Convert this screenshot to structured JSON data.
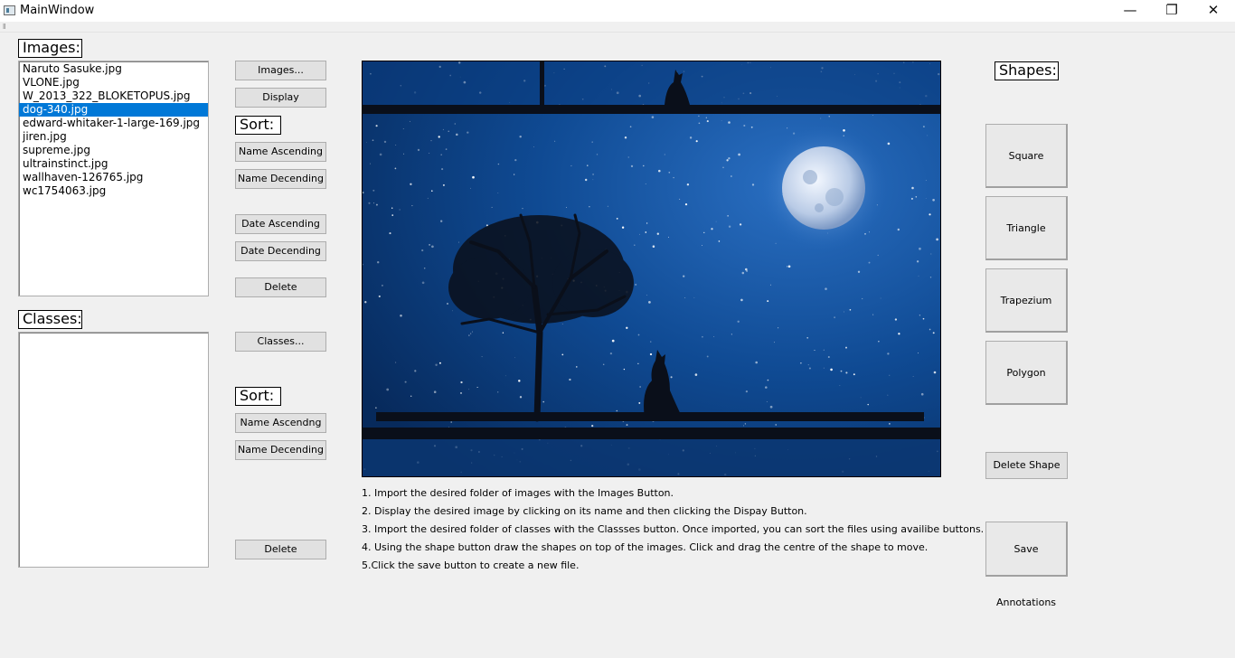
{
  "window": {
    "title": "MainWindow",
    "minimize_glyph": "—",
    "maximize_glyph": "❐",
    "close_glyph": "✕"
  },
  "images_panel": {
    "label": "Images:",
    "files": [
      "Naruto Sasuke.jpg",
      "VLONE.jpg",
      "W_2013_322_BLOKETOPUS.jpg",
      "dog-340.jpg",
      "edward-whitaker-1-large-169.jpg",
      "jiren.jpg",
      "supreme.jpg",
      "ultrainstinct.jpg",
      "wallhaven-126765.jpg",
      "wc1754063.jpg"
    ],
    "selected_file": "dog-340.jpg"
  },
  "classes_panel": {
    "label": "Classes:",
    "items": []
  },
  "buttons": {
    "images": "Images...",
    "display": "Display",
    "sort_label_1": "Sort:",
    "name_ascending": "Name Ascending",
    "name_decending": "Name Decending",
    "date_ascending": "Date Ascending",
    "date_decending": "Date Decending",
    "delete_image": "Delete",
    "classes": "Classes...",
    "sort_label_2": "Sort:",
    "class_name_ascending": "Name Ascendng",
    "class_name_decending": "Name Decending",
    "delete_class": "Delete"
  },
  "shapes_panel": {
    "label": "Shapes:",
    "square": "Square",
    "triangle": "Triangle",
    "trapezium": "Trapezium",
    "polygon": "Polygon",
    "delete_shape": "Delete Shape",
    "save_annotations": "Save Annotations"
  },
  "instructions": [
    "1. Import the desired folder of images with the Images Button.",
    "2. Display the desired image by clicking on its name and then clicking the Dispay Button.",
    "3. Import the desired folder of classes with the Classses button. Once imported, you can sort the files using availibe buttons.",
    "4. Using the shape button draw the shapes on top of the images. Click and drag the centre of the shape to move.",
    "5.Click the save button to create a new file."
  ],
  "colors": {
    "selection": "#0078d7",
    "window_bg": "#f0f0f0",
    "night_sky": "#0c3a78"
  },
  "displayed_image": {
    "name": "dog-340.jpg",
    "content": "night sky with moon, tree and howling wolf silhouette"
  }
}
